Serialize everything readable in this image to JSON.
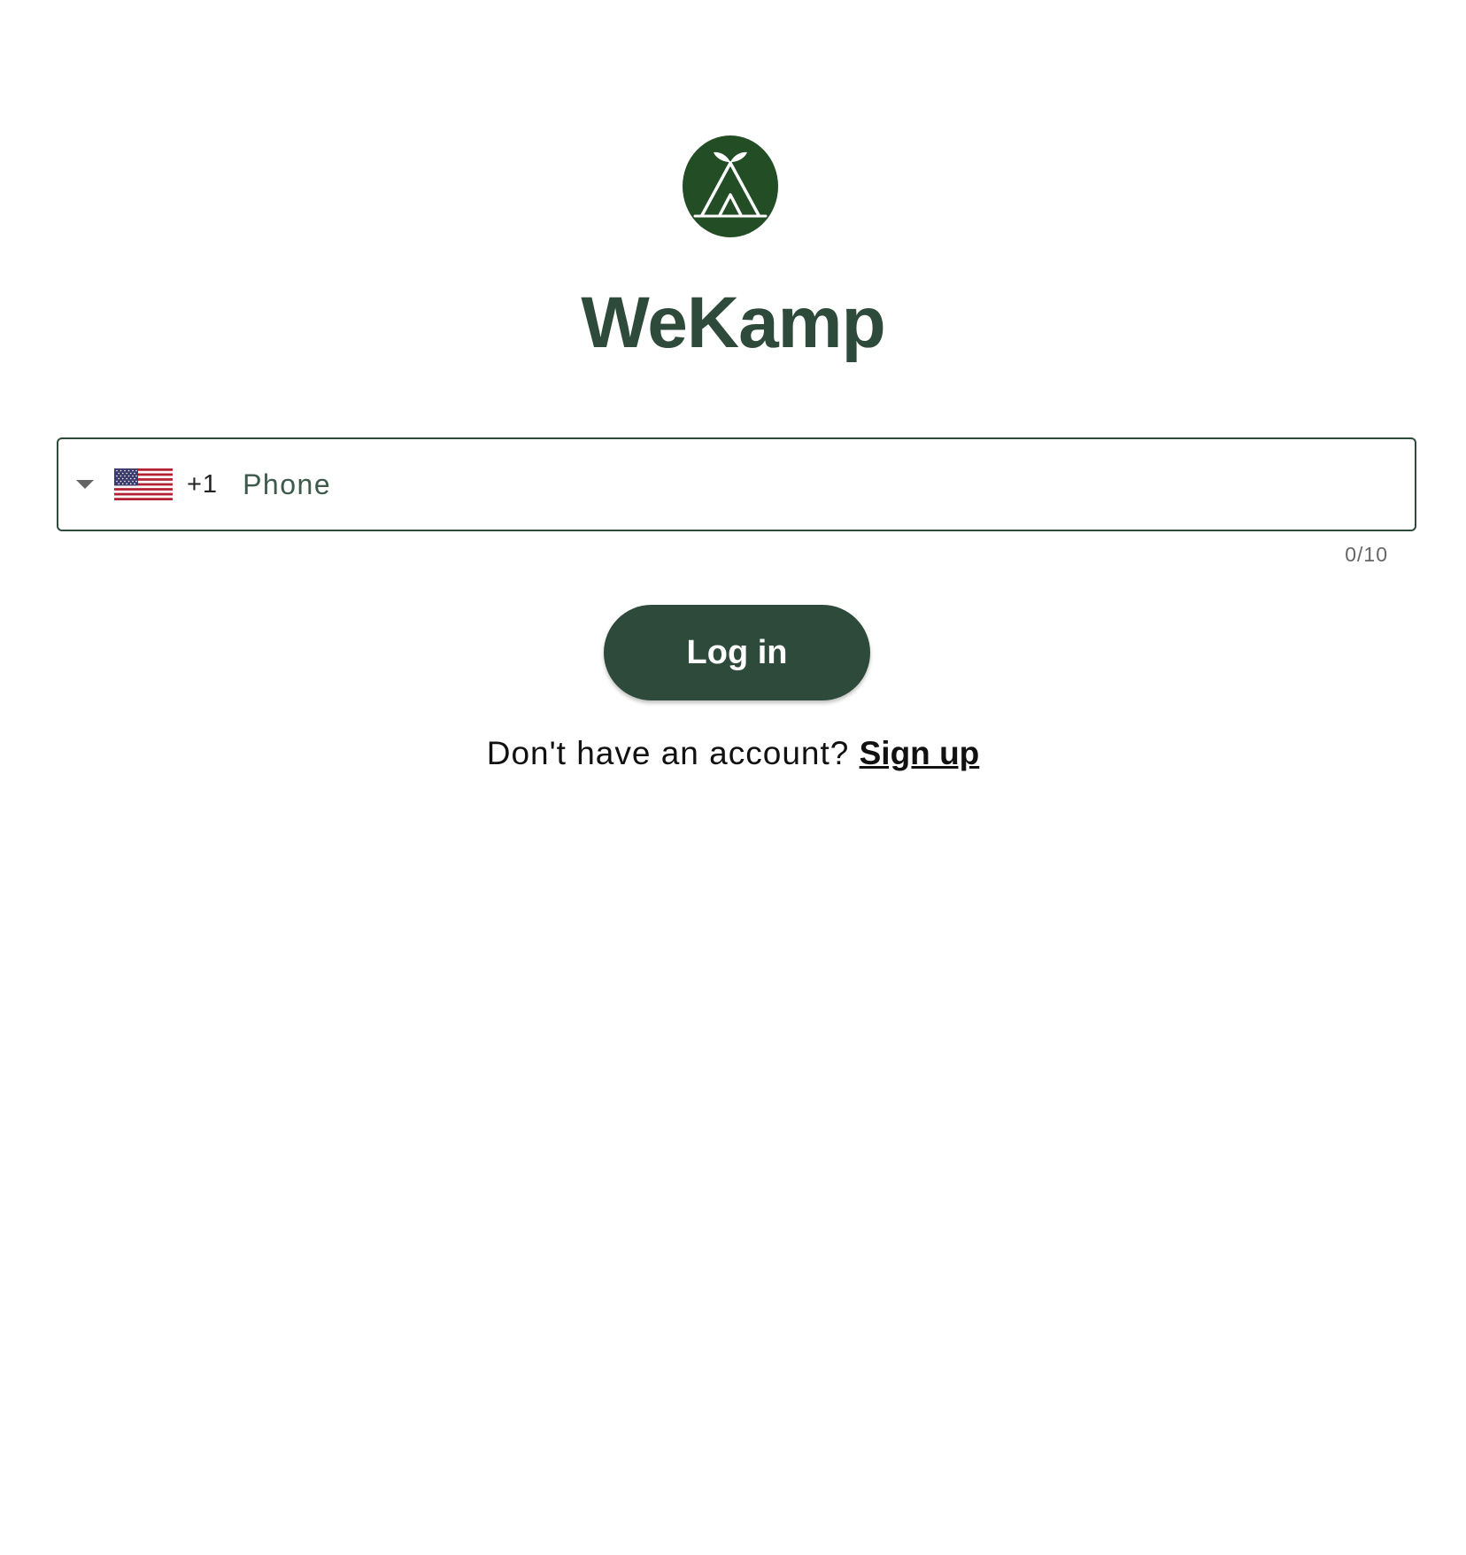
{
  "app": {
    "title": "WeKamp",
    "logo_icon": "tent-sprout-logo-icon",
    "brand_color": "#2e4a3b",
    "logo_color": "#224d25"
  },
  "phone_field": {
    "country_flag_icon": "us-flag-icon",
    "dropdown_icon": "caret-down-icon",
    "dial_code": "+1",
    "placeholder": "Phone",
    "value": "",
    "counter": "0/10"
  },
  "login_button": {
    "label": "Log in"
  },
  "signup": {
    "prompt": "Don't have an account?",
    "link_label": "Sign up"
  }
}
